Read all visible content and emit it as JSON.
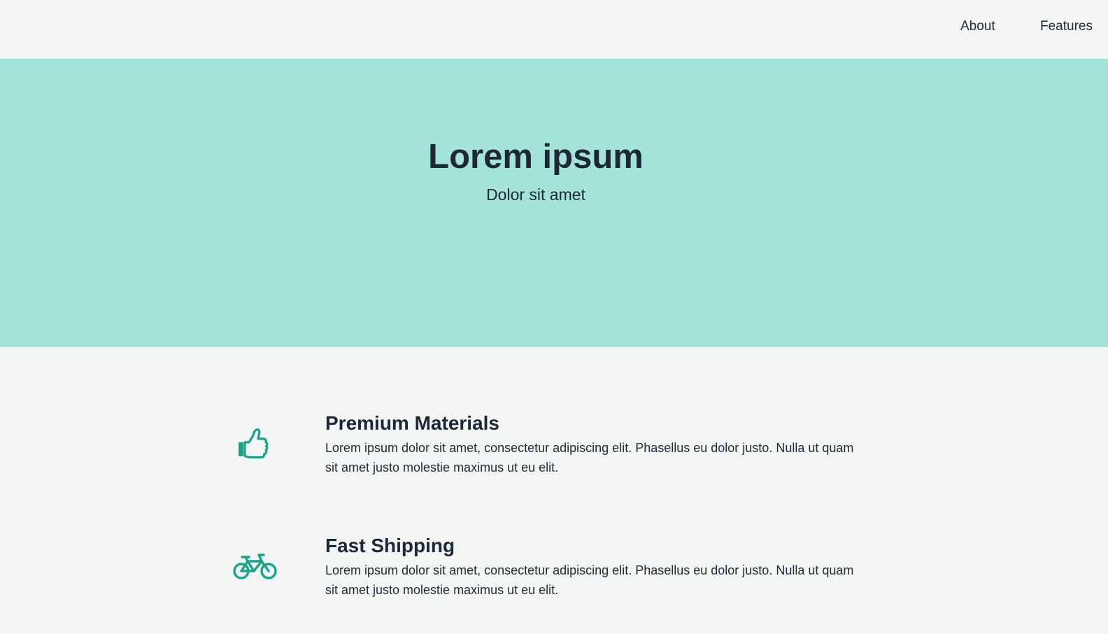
{
  "nav": {
    "items": [
      {
        "label": "About"
      },
      {
        "label": "Features"
      }
    ]
  },
  "hero": {
    "title": "Lorem ipsum",
    "subtitle": "Dolor sit amet",
    "background_color": "#a4e3d8"
  },
  "features": [
    {
      "icon": "thumbs-up-icon",
      "title": "Premium Materials",
      "text": "Lorem ipsum dolor sit amet, consectetur adipiscing elit. Phasellus eu dolor justo. Nulla ut quam sit amet justo molestie maximus ut eu elit."
    },
    {
      "icon": "bicycle-icon",
      "title": "Fast Shipping",
      "text": "Lorem ipsum dolor sit amet, consectetur adipiscing elit. Phasellus eu dolor justo. Nulla ut quam sit amet justo molestie maximus ut eu elit."
    }
  ],
  "colors": {
    "accent": "#17a589",
    "text": "#1f2a36",
    "page_background": "#f3f5f4"
  }
}
